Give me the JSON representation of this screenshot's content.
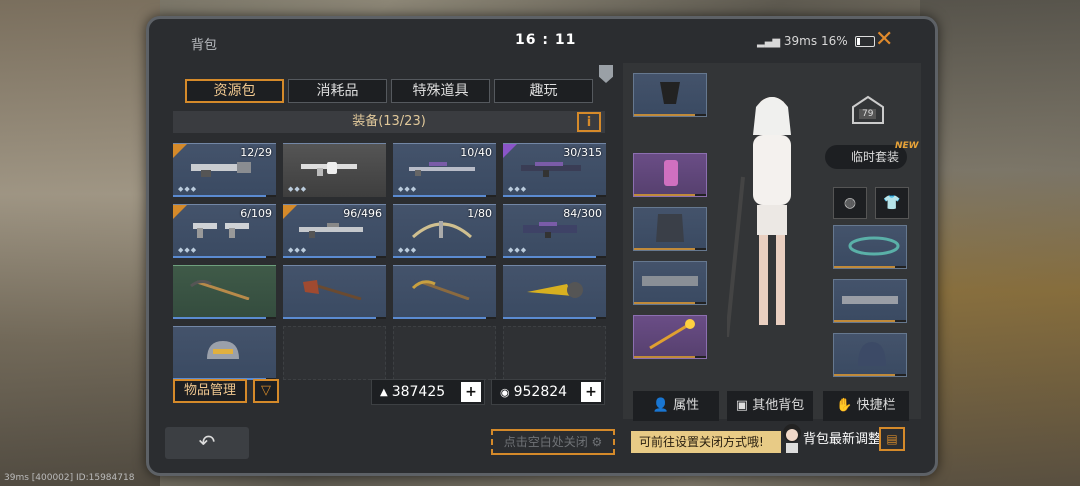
{
  "header": {
    "title": "背包",
    "time": "16 : 11",
    "network": "39ms",
    "battery": "16%"
  },
  "tabs": [
    {
      "label": "资源包",
      "active": true
    },
    {
      "label": "消耗品",
      "active": false
    },
    {
      "label": "特殊道具",
      "active": false
    },
    {
      "label": "趣玩",
      "active": false
    }
  ],
  "section": {
    "title": "装备(13/23)",
    "info_label": "i"
  },
  "grid": {
    "slots": [
      {
        "count": "12/29",
        "icon": "gatling-gun-icon"
      },
      {
        "count": "",
        "icon": "locked-rifle-icon"
      },
      {
        "count": "10/40",
        "icon": "sniper-rifle-icon"
      },
      {
        "count": "30/315",
        "icon": "assault-rifle-icon"
      },
      {
        "count": "6/109",
        "icon": "dual-pistols-icon"
      },
      {
        "count": "96/496",
        "icon": "rifle-icon"
      },
      {
        "count": "1/80",
        "icon": "crossbow-icon"
      },
      {
        "count": "84/300",
        "icon": "smg-icon"
      },
      {
        "count": "",
        "icon": "pickaxe-icon"
      },
      {
        "count": "",
        "icon": "axe-icon"
      },
      {
        "count": "",
        "icon": "pickaxe-icon"
      },
      {
        "count": "",
        "icon": "drill-icon"
      },
      {
        "count": "",
        "icon": "helmet-icon"
      }
    ]
  },
  "bottom": {
    "manage_label": "物品管理",
    "filter_icon": "filter-icon",
    "currency1": "387425",
    "currency2": "952824",
    "plus": "+"
  },
  "equipment": {
    "outfit_label": "临时套装",
    "new_tag": "NEW",
    "level": "79",
    "actions": [
      "属性",
      "其他背包",
      "快捷栏"
    ]
  },
  "footer": {
    "hint": "点击空白处关闭",
    "tip": "可前往设置关闭方式哦!",
    "adjust": "背包最新调整",
    "status_line": "39ms  [400002] ID:15984718"
  },
  "colors": {
    "accent": "#d58a2a",
    "slot_blue": "#44536b",
    "slot_purple": "#6a4d86"
  }
}
